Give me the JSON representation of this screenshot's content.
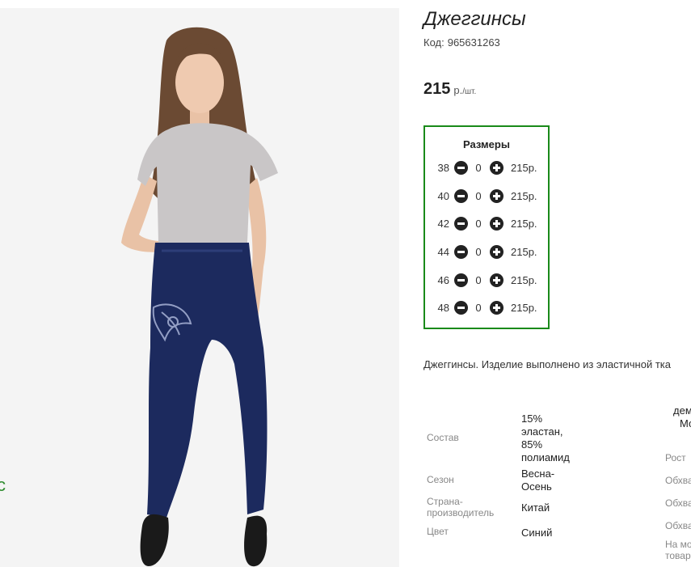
{
  "product": {
    "title": "Джеггинсы",
    "code_label": "Код:",
    "code_value": "965631263",
    "price_amount": "215",
    "price_currency": "р.",
    "price_per": "/шт.",
    "description": "Джеггинсы. Изделие выполнено из эластичной тка"
  },
  "sizes": {
    "title": "Размеры",
    "rows": [
      {
        "size": "38",
        "qty": "0",
        "price": "215р."
      },
      {
        "size": "40",
        "qty": "0",
        "price": "215р."
      },
      {
        "size": "42",
        "qty": "0",
        "price": "215р."
      },
      {
        "size": "44",
        "qty": "0",
        "price": "215р."
      },
      {
        "size": "46",
        "qty": "0",
        "price": "215р."
      },
      {
        "size": "48",
        "qty": "0",
        "price": "215р."
      }
    ]
  },
  "attributes": [
    {
      "label": "Состав",
      "value": "15% эластан, 85% полиамид"
    },
    {
      "label": "Сезон",
      "value": "Весна-Осень"
    },
    {
      "label": "Страна-производитель",
      "value": "Китай"
    },
    {
      "label": "Цвет",
      "value": "Синий"
    }
  ],
  "model_params": {
    "heading_line1": "дем",
    "heading_line2": "Мо",
    "labels": [
      "Рост",
      "Обхва",
      "Обхва",
      "Обхва",
      "На мо",
      "товар"
    ]
  },
  "edge_glyph": "с",
  "colors": {
    "sizes_border": "#1a8a1a",
    "button": "#222222",
    "photo_bg": "#f4f4f4",
    "jeans": "#1c2a5e",
    "tshirt": "#c9c6c7"
  },
  "icons": [
    "minus-circle-icon",
    "plus-circle-icon"
  ]
}
